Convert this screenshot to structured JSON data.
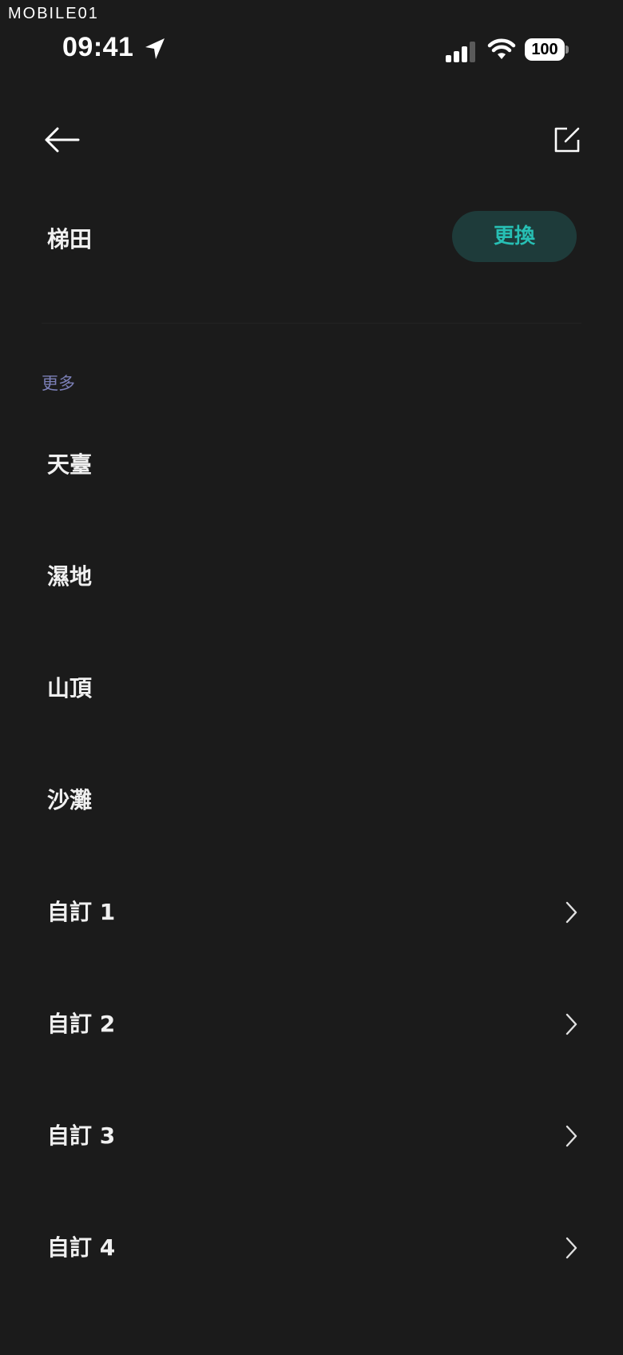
{
  "watermark": "MOBILE01",
  "status_bar": {
    "time": "09:41",
    "battery": "100",
    "icons": [
      "location-arrow-icon",
      "cellular-signal-icon",
      "wifi-icon",
      "battery-icon"
    ]
  },
  "nav": {
    "back_icon": "arrow-left-icon",
    "edit_icon": "edit-square-icon"
  },
  "current": {
    "label": "梯田",
    "change_button": "更換"
  },
  "section": {
    "title": "更多"
  },
  "items": [
    {
      "label": "天臺",
      "has_chevron": false
    },
    {
      "label": "濕地",
      "has_chevron": false
    },
    {
      "label": "山頂",
      "has_chevron": false
    },
    {
      "label": "沙灘",
      "has_chevron": false
    },
    {
      "label": "自訂 1",
      "has_chevron": true
    },
    {
      "label": "自訂 2",
      "has_chevron": true
    },
    {
      "label": "自訂 3",
      "has_chevron": true
    },
    {
      "label": "自訂 4",
      "has_chevron": true
    }
  ],
  "colors": {
    "background": "#1b1b1b",
    "accent_text": "#27bfb4",
    "accent_bg": "#1e3b3a",
    "section_title": "#7b7fb6"
  }
}
